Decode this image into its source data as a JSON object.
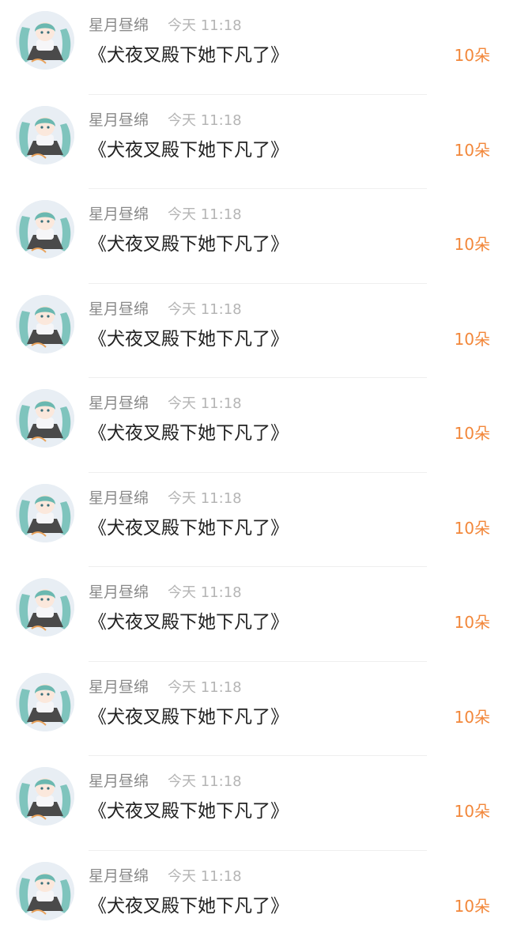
{
  "colors": {
    "accent": "#f2873a",
    "name": "#8a8a8a",
    "time": "#b5b5b5",
    "title": "#222222"
  },
  "rows": [
    {
      "avatar_icon": "anime-girl-avatar",
      "name": "星月昼绵",
      "time": "今天 11:18",
      "title": "《犬夜叉殿下她下凡了》",
      "gift": "10朵"
    },
    {
      "avatar_icon": "anime-girl-avatar",
      "name": "星月昼绵",
      "time": "今天 11:18",
      "title": "《犬夜叉殿下她下凡了》",
      "gift": "10朵"
    },
    {
      "avatar_icon": "anime-girl-avatar",
      "name": "星月昼绵",
      "time": "今天 11:18",
      "title": "《犬夜叉殿下她下凡了》",
      "gift": "10朵"
    },
    {
      "avatar_icon": "anime-girl-avatar",
      "name": "星月昼绵",
      "time": "今天 11:18",
      "title": "《犬夜叉殿下她下凡了》",
      "gift": "10朵"
    },
    {
      "avatar_icon": "anime-girl-avatar",
      "name": "星月昼绵",
      "time": "今天 11:18",
      "title": "《犬夜叉殿下她下凡了》",
      "gift": "10朵"
    },
    {
      "avatar_icon": "anime-girl-avatar",
      "name": "星月昼绵",
      "time": "今天 11:18",
      "title": "《犬夜叉殿下她下凡了》",
      "gift": "10朵"
    },
    {
      "avatar_icon": "anime-girl-avatar",
      "name": "星月昼绵",
      "time": "今天 11:18",
      "title": "《犬夜叉殿下她下凡了》",
      "gift": "10朵"
    },
    {
      "avatar_icon": "anime-girl-avatar",
      "name": "星月昼绵",
      "time": "今天 11:18",
      "title": "《犬夜叉殿下她下凡了》",
      "gift": "10朵"
    },
    {
      "avatar_icon": "anime-girl-avatar",
      "name": "星月昼绵",
      "time": "今天 11:18",
      "title": "《犬夜叉殿下她下凡了》",
      "gift": "10朵"
    },
    {
      "avatar_icon": "anime-girl-avatar",
      "name": "星月昼绵",
      "time": "今天 11:18",
      "title": "《犬夜叉殿下她下凡了》",
      "gift": "10朵"
    }
  ]
}
